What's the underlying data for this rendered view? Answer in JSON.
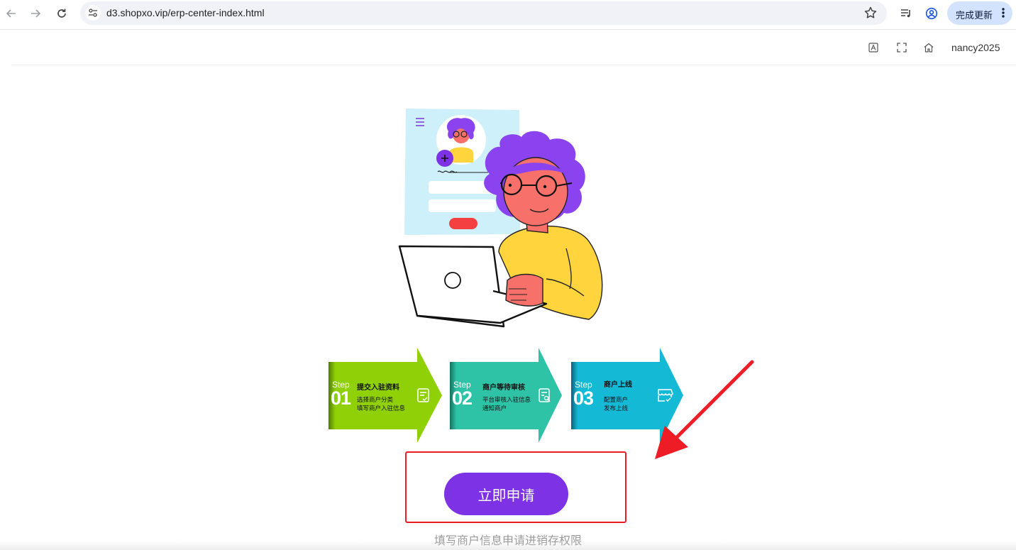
{
  "browser": {
    "url": "d3.shopxo.vip/erp-center-index.html",
    "update_label": "完成更新",
    "icons": [
      "back-icon",
      "forward-icon",
      "reload-icon",
      "site-info-icon",
      "star-icon",
      "media-icon",
      "profile-icon",
      "more-icon"
    ]
  },
  "header": {
    "username": "nancy2025",
    "icons": [
      "translate-icon",
      "fullscreen-icon",
      "home-icon"
    ]
  },
  "steps": [
    {
      "word": "Step",
      "num": "01",
      "title": "提交入驻资料",
      "desc1": "选择商户分类",
      "desc2": "填写商户入驻信息",
      "color": "#8fd006",
      "icon": "document-check-icon"
    },
    {
      "word": "Step",
      "num": "02",
      "title": "商户等待审核",
      "desc1": "平台审核入驻信息",
      "desc2": "通知商户",
      "color": "#2ec3a6",
      "icon": "document-search-icon"
    },
    {
      "word": "Step",
      "num": "03",
      "title": "商户上线",
      "desc1": "配置商户",
      "desc2": "发布上线",
      "color": "#14b9d6",
      "icon": "storefront-check-icon"
    }
  ],
  "apply": {
    "button_label": "立即申请",
    "hint": "填写商户信息申请进销存权限"
  },
  "colors": {
    "accent": "#7e32e6",
    "highlight": "#ee1c25"
  }
}
